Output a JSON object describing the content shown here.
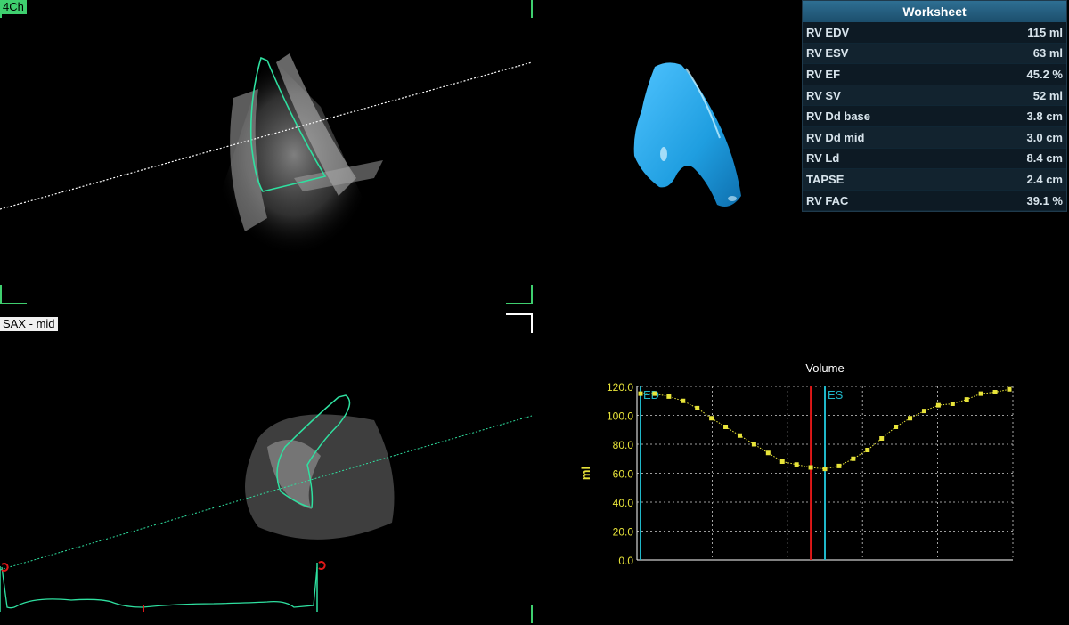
{
  "views": {
    "top_label": "4Ch",
    "bottom_label": "SAX - mid"
  },
  "worksheet": {
    "title": "Worksheet",
    "rows": [
      {
        "label": "RV EDV",
        "value": "115 ml"
      },
      {
        "label": "RV ESV",
        "value": "63 ml"
      },
      {
        "label": "RV EF",
        "value": "45.2 %"
      },
      {
        "label": "RV SV",
        "value": "52 ml"
      },
      {
        "label": "RV Dd base",
        "value": "3.8 cm"
      },
      {
        "label": "RV Dd mid",
        "value": "3.0 cm"
      },
      {
        "label": "RV Ld",
        "value": "8.4 cm"
      },
      {
        "label": "TAPSE",
        "value": "2.4 cm"
      },
      {
        "label": "RV FAC",
        "value": "39.1 %"
      }
    ]
  },
  "colors": {
    "label_green": "#3fcf6f",
    "contour": "#2fe0a0",
    "model_blue": "#2aa6e6",
    "curve_yellow": "#e8e43a",
    "marker_cyan": "#1fb7c9",
    "marker_red": "#e01818"
  },
  "chart_data": {
    "type": "line",
    "title": "Volume",
    "xlabel": "",
    "ylabel": "ml",
    "ylim": [
      0,
      120
    ],
    "yticks": [
      "0.0",
      "20.0",
      "40.0",
      "60.0",
      "80.0",
      "100.0",
      "120.0"
    ],
    "grid": true,
    "series": [
      {
        "values": [
          115,
          115,
          113,
          110,
          105,
          98,
          92,
          86,
          80,
          74,
          68,
          66,
          64,
          63,
          65,
          70,
          76,
          84,
          92,
          98,
          103,
          107,
          108,
          111,
          115,
          116,
          118
        ]
      }
    ],
    "markers": [
      {
        "label": "ED",
        "index": 0,
        "color": "#1fb7c9"
      },
      {
        "label": "ES",
        "index": 13,
        "color": "#1fb7c9"
      },
      {
        "label": "",
        "index": 12,
        "color": "#e01818"
      }
    ]
  }
}
